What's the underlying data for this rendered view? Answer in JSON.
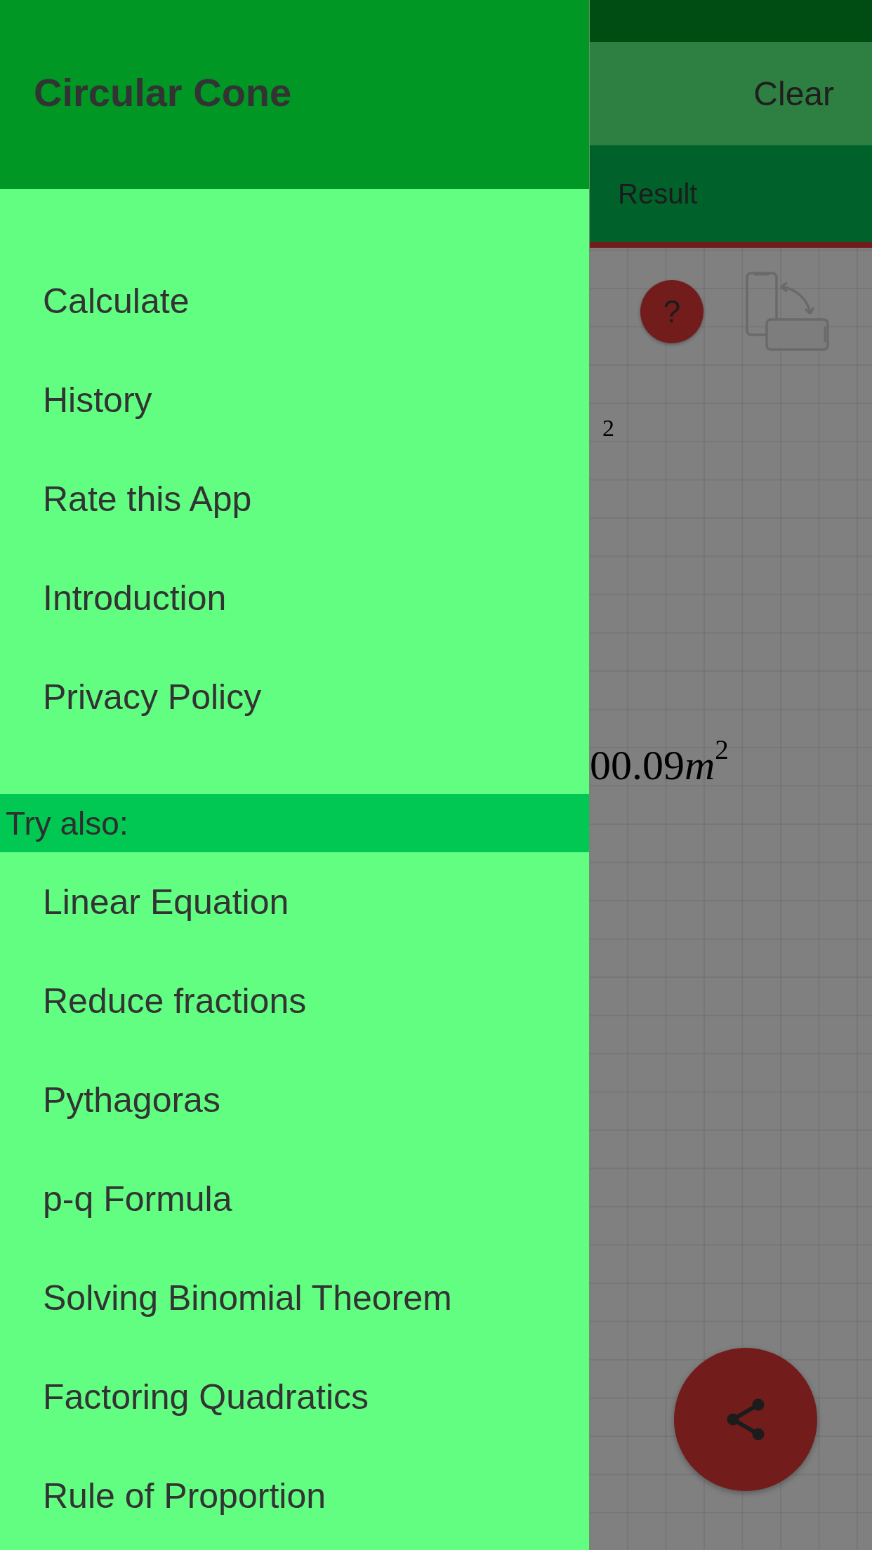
{
  "drawer": {
    "title": "Circular Cone",
    "items": [
      "Calculate",
      "History",
      "Rate this App",
      "Introduction",
      "Privacy Policy"
    ],
    "section": {
      "heading": "Try also:",
      "items": [
        "Linear Equation",
        "Reduce fractions",
        "Pythagoras",
        "p-q Formula",
        "Solving Binomial Theorem",
        "Factoring Quadratics",
        "Rule of Proportion"
      ]
    }
  },
  "app": {
    "toolbar": {
      "action": "Clear"
    },
    "tabs": [
      {
        "label": "Result",
        "selected": true
      }
    ],
    "help_button": {
      "label": "?"
    },
    "results": [
      {
        "kind": "exponent",
        "exponent": "2"
      },
      {
        "kind": "formula",
        "value": "00.09",
        "unit": "m",
        "exponent": "2"
      }
    ]
  }
}
